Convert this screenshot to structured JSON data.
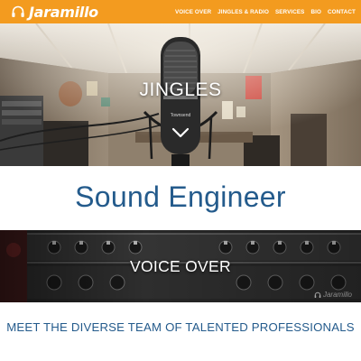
{
  "header": {
    "logo_text": "Jaramillo",
    "logo_icon": "headphones-icon",
    "nav": [
      {
        "label": "VOICE OVER"
      },
      {
        "label": "JINGLES & RADIO"
      },
      {
        "label": "SERVICES"
      },
      {
        "label": "BIO"
      },
      {
        "label": "CONTACT"
      }
    ]
  },
  "hero": {
    "title": "JINGLES",
    "mic_brand": "Townsend",
    "chevron_icon": "chevron-down-icon"
  },
  "band": {
    "title": "Sound Engineer"
  },
  "voice_over": {
    "title": "VOICE OVER",
    "watermark": "Jaramillo"
  },
  "tagline": {
    "text": "MEET THE DIVERSE TEAM OF TALENTED PROFESSIONALS"
  },
  "colors": {
    "header_bg": "#f39b1f",
    "accent_blue": "#245b8c",
    "text_white": "#ffffff"
  }
}
